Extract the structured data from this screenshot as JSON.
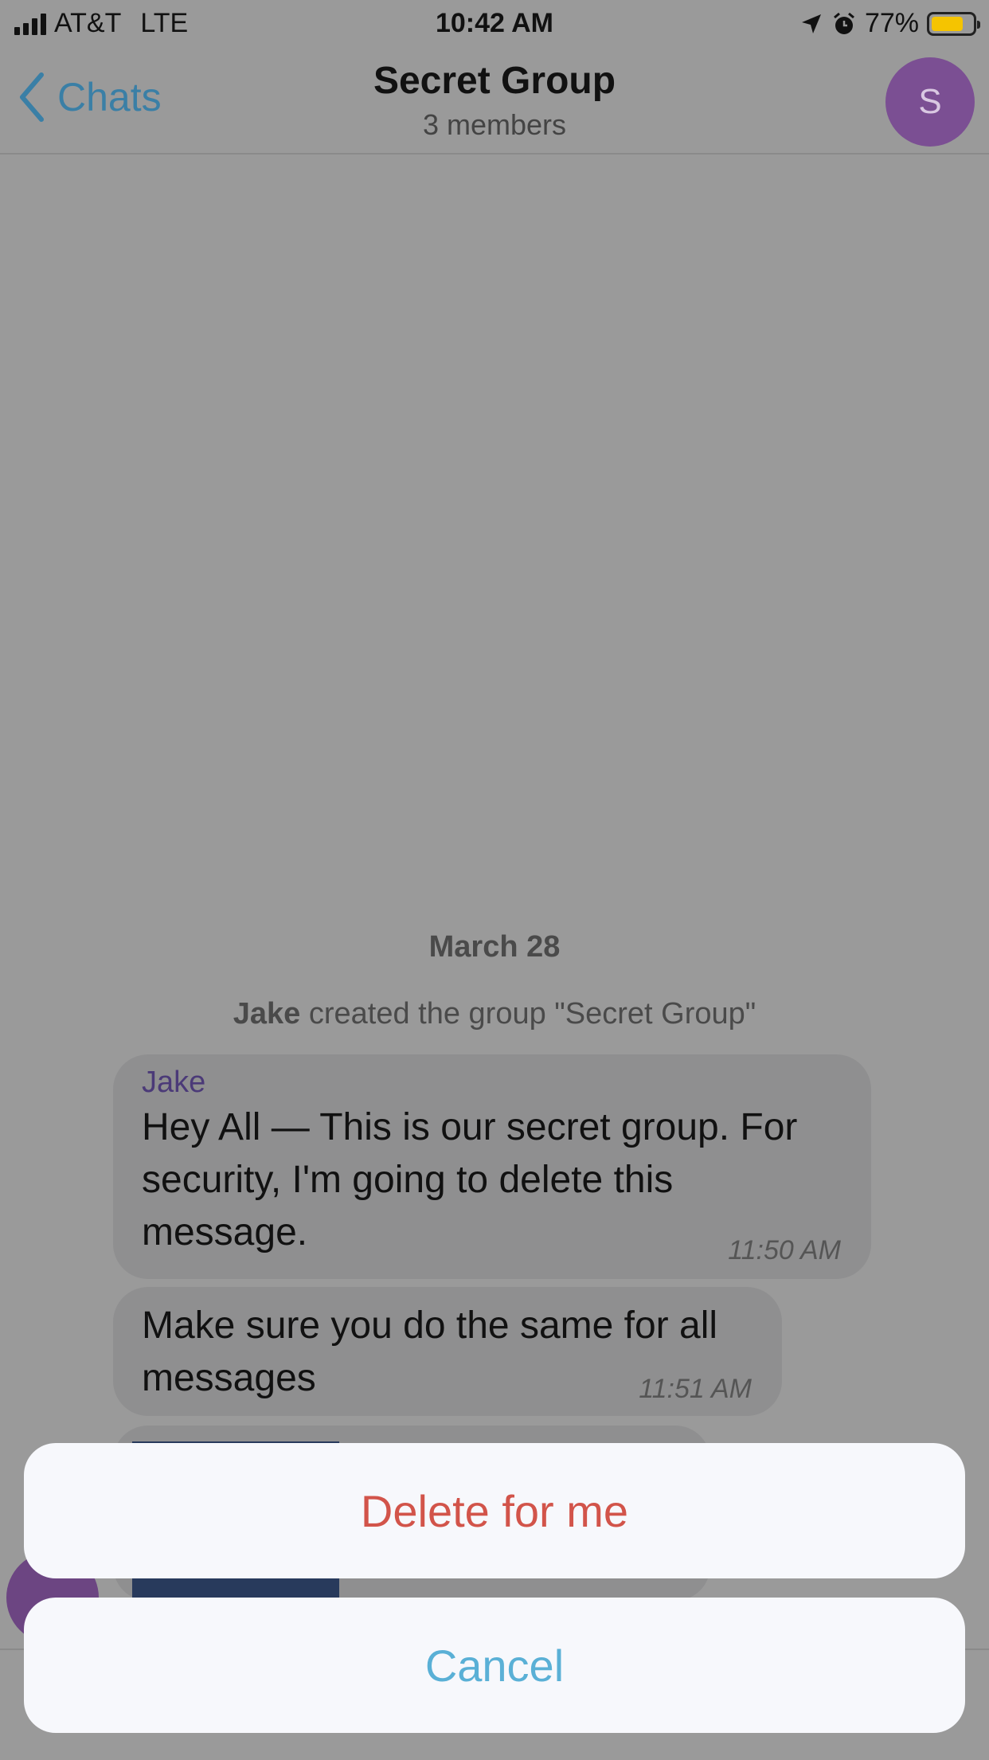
{
  "status_bar": {
    "carrier": "AT&T",
    "network": "LTE",
    "time": "10:42 AM",
    "battery_percent_label": "77%",
    "battery_level": 0.77,
    "battery_color": "#f5c400"
  },
  "nav": {
    "back_label": "Chats",
    "title": "Secret Group",
    "subtitle": "3 members",
    "avatar_initial": "S",
    "accent_color": "#3a7fa6"
  },
  "chat": {
    "date_label": "March 28",
    "system_message": {
      "actor": "Jake",
      "text": "created the group \"Secret Group\""
    },
    "messages": [
      {
        "sender": "Jake",
        "text_lines": [
          "Hey All — This is our secret group. For",
          "security, I'm going to delete this",
          "message."
        ],
        "time": "11:50 AM"
      },
      {
        "text_lines": [
          "Make sure you do the same for all",
          "messages"
        ],
        "time": "11:51 AM"
      }
    ]
  },
  "action_sheet": {
    "delete_label": "Delete for me",
    "cancel_label": "Cancel",
    "destructive_color": "#d2544a",
    "cancel_color": "#5ab0d6"
  },
  "icons": [
    "signal-icon",
    "location-arrow-icon",
    "alarm-icon",
    "battery-icon",
    "chevron-left-icon"
  ]
}
